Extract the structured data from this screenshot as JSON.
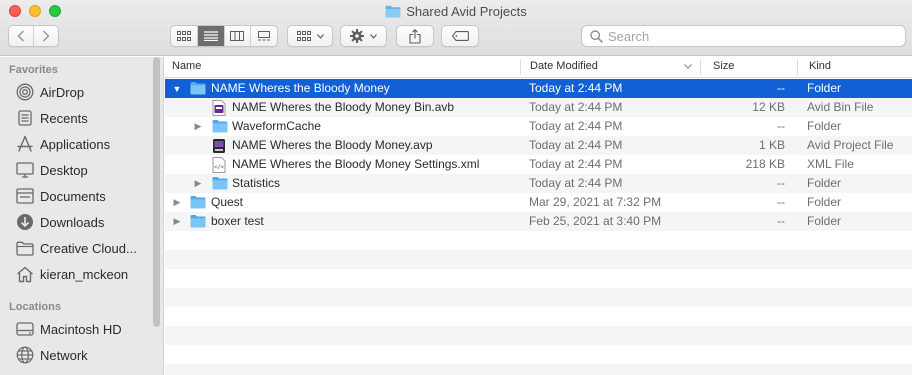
{
  "window": {
    "title": "Shared Avid Projects"
  },
  "toolbar": {
    "back_icon": "chevron-left-icon",
    "forward_icon": "chevron-right-icon",
    "view_modes": [
      "icon-view",
      "list-view",
      "column-view",
      "gallery-view"
    ],
    "active_view": "list-view",
    "group_icon": "group-icon",
    "action_icon": "gear-icon",
    "share_icon": "share-icon",
    "tag_icon": "tag-icon"
  },
  "search": {
    "placeholder": "Search"
  },
  "sidebar": {
    "favorites_heading": "Favorites",
    "favorites": [
      {
        "label": "AirDrop",
        "icon": "airdrop-icon"
      },
      {
        "label": "Recents",
        "icon": "recents-icon"
      },
      {
        "label": "Applications",
        "icon": "applications-icon"
      },
      {
        "label": "Desktop",
        "icon": "desktop-icon"
      },
      {
        "label": "Documents",
        "icon": "documents-icon"
      },
      {
        "label": "Downloads",
        "icon": "downloads-icon"
      },
      {
        "label": "Creative Cloud...",
        "icon": "folder-icon"
      },
      {
        "label": "kieran_mckeon",
        "icon": "home-icon"
      }
    ],
    "locations_heading": "Locations",
    "locations": [
      {
        "label": "Macintosh HD",
        "icon": "hard-drive-icon"
      },
      {
        "label": "Network",
        "icon": "network-icon"
      }
    ]
  },
  "columns": {
    "name": "Name",
    "date": "Date Modified",
    "size": "Size",
    "kind": "Kind"
  },
  "files": [
    {
      "name": "NAME Wheres the Bloody Money",
      "date": "Today at 2:44 PM",
      "size": "--",
      "kind": "Folder",
      "indent": 0,
      "disclosure": "open",
      "icon": "folder-icon",
      "selected": true
    },
    {
      "name": "NAME Wheres the Bloody Money Bin.avb",
      "date": "Today at 2:44 PM",
      "size": "12 KB",
      "kind": "Avid Bin File",
      "indent": 1,
      "disclosure": "none",
      "icon": "avid-bin-icon",
      "selected": false
    },
    {
      "name": "WaveformCache",
      "date": "Today at 2:44 PM",
      "size": "--",
      "kind": "Folder",
      "indent": 1,
      "disclosure": "closed",
      "icon": "folder-icon",
      "selected": false
    },
    {
      "name": "NAME Wheres the Bloody Money.avp",
      "date": "Today at 2:44 PM",
      "size": "1 KB",
      "kind": "Avid Project File",
      "indent": 1,
      "disclosure": "none",
      "icon": "avid-project-icon",
      "selected": false
    },
    {
      "name": "NAME Wheres the Bloody Money Settings.xml",
      "date": "Today at 2:44 PM",
      "size": "218 KB",
      "kind": "XML File",
      "indent": 1,
      "disclosure": "none",
      "icon": "xml-file-icon",
      "selected": false
    },
    {
      "name": "Statistics",
      "date": "Today at 2:44 PM",
      "size": "--",
      "kind": "Folder",
      "indent": 1,
      "disclosure": "closed",
      "icon": "folder-icon",
      "selected": false
    },
    {
      "name": "Quest",
      "date": "Mar 29, 2021 at 7:32 PM",
      "size": "--",
      "kind": "Folder",
      "indent": 0,
      "disclosure": "closed",
      "icon": "folder-icon",
      "selected": false
    },
    {
      "name": "boxer test",
      "date": "Feb 25, 2021 at 3:40 PM",
      "size": "--",
      "kind": "Folder",
      "indent": 0,
      "disclosure": "closed",
      "icon": "folder-icon",
      "selected": false
    }
  ],
  "colors": {
    "selection": "#1160d6",
    "folder": "#5fb6f2",
    "sidebar_bg": "#e9e8e8"
  }
}
